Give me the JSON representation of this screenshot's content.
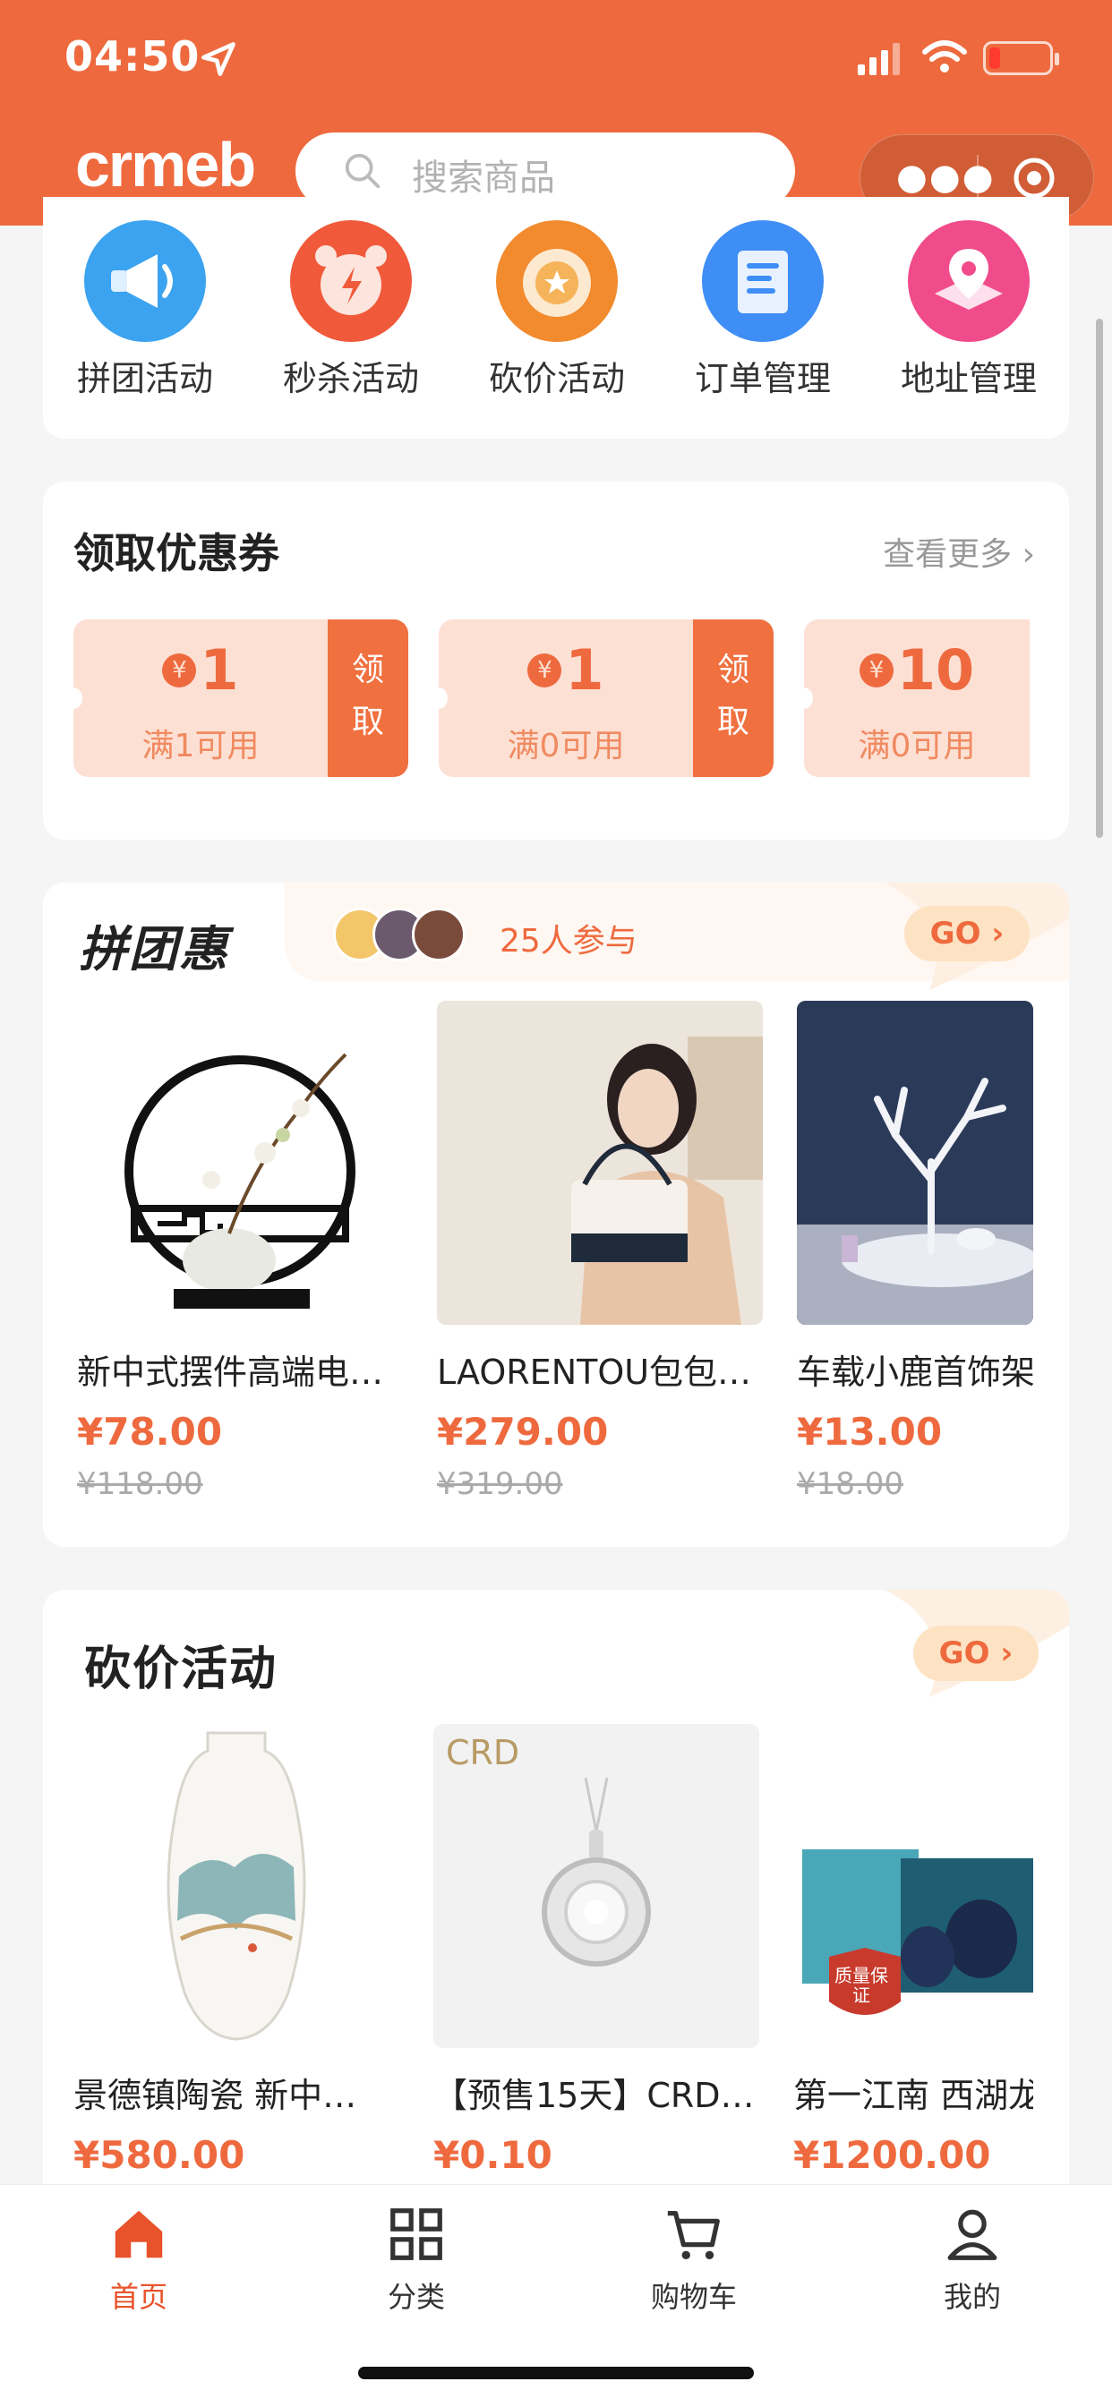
{
  "status": {
    "time": "04:50"
  },
  "header": {
    "logo": "crmeb",
    "search_placeholder": "搜索商品"
  },
  "nav": [
    {
      "label": "拼团活动",
      "icon": "megaphone-icon",
      "color": "#3ba3f0"
    },
    {
      "label": "秒杀活动",
      "icon": "alarm-clock-icon",
      "color": "#f05a3a"
    },
    {
      "label": "砍价活动",
      "icon": "medal-icon",
      "color": "#f28a2e"
    },
    {
      "label": "订单管理",
      "icon": "document-icon",
      "color": "#3e8ef5"
    },
    {
      "label": "地址管理",
      "icon": "map-pin-icon",
      "color": "#f04b8a"
    }
  ],
  "coupons": {
    "title": "领取优惠券",
    "more": "查看更多",
    "items": [
      {
        "yen": "¥",
        "amount": "1",
        "condition": "满1可用",
        "action": "领取"
      },
      {
        "yen": "¥",
        "amount": "1",
        "condition": "满0可用",
        "action": "领取"
      },
      {
        "yen": "¥",
        "amount": "10",
        "condition": "满0可用",
        "action": ""
      }
    ]
  },
  "group": {
    "title": "拼团惠",
    "participants": "25人参与",
    "go": "GO",
    "products": [
      {
        "name": "新中式摆件高端电…",
        "price": "¥78.00",
        "old_price": "¥118.00"
      },
      {
        "name": "LAORENTOU包包…",
        "price": "¥279.00",
        "old_price": "¥319.00"
      },
      {
        "name": "车载小鹿首饰架",
        "price": "¥13.00",
        "old_price": "¥18.00"
      }
    ]
  },
  "bargain": {
    "title": "砍价活动",
    "go": "GO",
    "products": [
      {
        "name": "景德镇陶瓷 新中…",
        "price": "¥580.00",
        "img_text": ""
      },
      {
        "name": "【预售15天】CRD…",
        "price": "¥0.10",
        "img_text": "CRD"
      },
      {
        "name": "第一江南 西湖龙",
        "price": "¥1200.00",
        "img_text": "质量保证"
      }
    ]
  },
  "tabbar": [
    {
      "label": "首页",
      "icon": "home-icon",
      "active": true
    },
    {
      "label": "分类",
      "icon": "grid-icon",
      "active": false
    },
    {
      "label": "购物车",
      "icon": "cart-icon",
      "active": false
    },
    {
      "label": "我的",
      "icon": "user-icon",
      "active": false
    }
  ],
  "colors": {
    "brand": "#ee6a3e",
    "active_tab": "#e8532b"
  }
}
